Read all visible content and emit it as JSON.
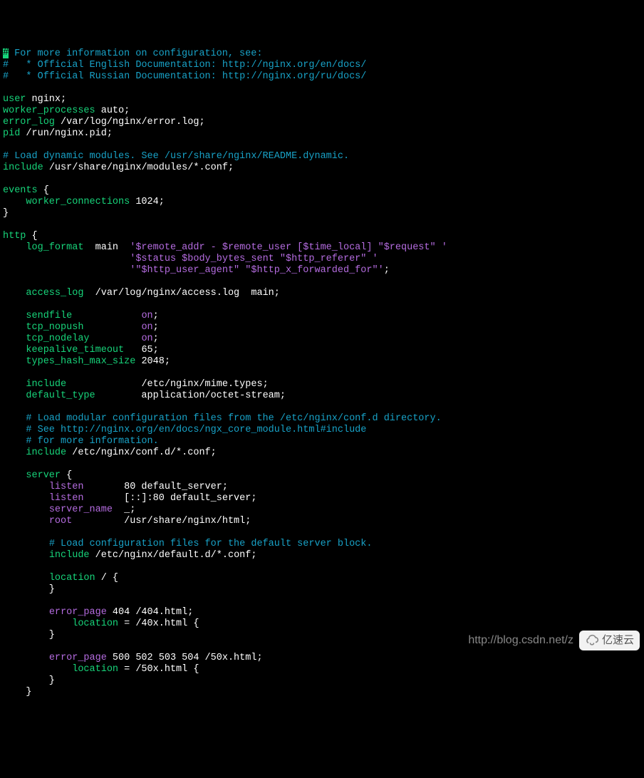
{
  "comments": {
    "c1": " For more information on configuration, see:",
    "c2": "#   * Official English Documentation: http://nginx.org/en/docs/",
    "c3": "#   * Official Russian Documentation: http://nginx.org/ru/docs/",
    "c4": "# Load dynamic modules. See /usr/share/nginx/README.dynamic.",
    "c5": "# Load modular configuration files from the /etc/nginx/conf.d directory.",
    "c6": "# See http://nginx.org/en/docs/ngx_core_module.html#include",
    "c7": "# for more information.",
    "c8": "# Load configuration files for the default server block."
  },
  "directives": {
    "user": "user",
    "worker_processes": "worker_processes",
    "error_log": "error_log",
    "pid": "pid",
    "include": "include",
    "events": "events",
    "worker_connections": "worker_connections",
    "http": "http",
    "log_format": "log_format",
    "access_log": "access_log",
    "sendfile": "sendfile",
    "tcp_nopush": "tcp_nopush",
    "tcp_nodelay": "tcp_nodelay",
    "keepalive_timeout": "keepalive_timeout",
    "types_hash_max_size": "types_hash_max_size",
    "default_type": "default_type",
    "server": "server",
    "listen": "listen",
    "server_name": "server_name",
    "root": "root",
    "location": "location",
    "error_page": "error_page"
  },
  "values": {
    "user_val": " nginx;",
    "wp_val": " auto;",
    "errlog_val": " /var/log/nginx/error.log;",
    "pid_val": " /run/nginx.pid;",
    "include_mod": " /usr/share/nginx/modules/*.conf;",
    "wc_val": " 1024;",
    "lf_main": "  main  ",
    "lf_l1": "'$remote_addr - $remote_user [$time_local] \"$request\" '",
    "lf_l2": "'$status $body_bytes_sent \"$http_referer\" '",
    "lf_l3": "'\"$http_user_agent\" \"$http_x_forwarded_for\"'",
    "semicolon": ";",
    "access_val": "  /var/log/nginx/access.log  main;",
    "on": "on",
    "kt_val": "   65;",
    "thms_val": " 2048;",
    "inc_mime": "             /etc/nginx/mime.types;",
    "deftype_val": "        application/octet-stream;",
    "inc_confd": " /etc/nginx/conf.d/*.conf;",
    "listen80": "       80 default_server;",
    "listen80v6": "       [::]:80 default_server;",
    "sname_val": "  _;",
    "root_val": "         /usr/share/nginx/html;",
    "inc_default": " /etc/nginx/default.d/*.conf;",
    "loc_root": " / {",
    "ep404": " 404 /404.html;",
    "loc40x": " = /40x.html {",
    "ep50x": " 500 502 503 504 /50x.html;",
    "loc50x": " = /50x.html {"
  },
  "pads": {
    "sf": "            ",
    "tn": "          ",
    "tnd": "         ",
    "lf_indent": "                      "
  },
  "watermark": {
    "url": "http://blog.csdn.net/z",
    "brand": "亿速云"
  }
}
